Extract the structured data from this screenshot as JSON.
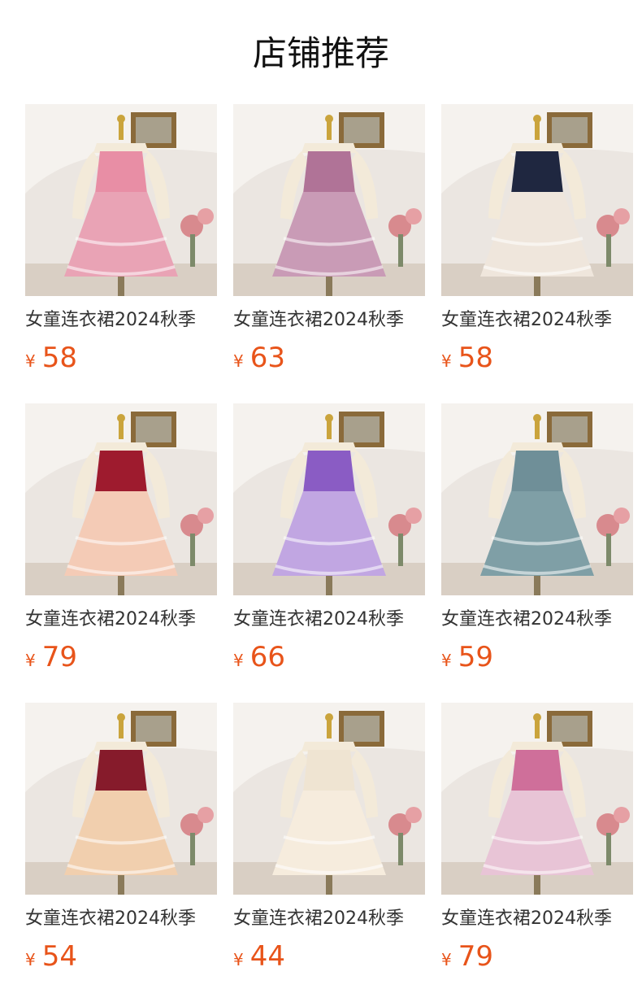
{
  "header": {
    "title": "店铺推荐"
  },
  "products": [
    {
      "name": "女童连衣裙2024秋季",
      "currency": "¥",
      "price": "58",
      "dress_color": "#e9a3b5",
      "top_color": "#e88ea5",
      "icon": "pink-tiered-dress-photo"
    },
    {
      "name": "女童连衣裙2024秋季",
      "currency": "¥",
      "price": "63",
      "dress_color": "#c99bb6",
      "top_color": "#b07397",
      "icon": "mauve-ruffle-dress-photo"
    },
    {
      "name": "女童连衣裙2024秋季",
      "currency": "¥",
      "price": "58",
      "dress_color": "#efe6dc",
      "top_color": "#1f2740",
      "icon": "navy-sequin-tulle-dress-photo"
    },
    {
      "name": "女童连衣裙2024秋季",
      "currency": "¥",
      "price": "79",
      "dress_color": "#f4cbb6",
      "top_color": "#9e1b2e",
      "icon": "burgundy-velvet-tiered-dress-photo"
    },
    {
      "name": "女童连衣裙2024秋季",
      "currency": "¥",
      "price": "66",
      "dress_color": "#c1a6e2",
      "top_color": "#8a5cc4",
      "icon": "purple-sequin-tiered-dress-photo"
    },
    {
      "name": "女童连衣裙2024秋季",
      "currency": "¥",
      "price": "59",
      "dress_color": "#7f9fa6",
      "top_color": "#6f8f98",
      "icon": "teal-tulle-dress-photo"
    },
    {
      "name": "女童连衣裙2024秋季",
      "currency": "¥",
      "price": "54",
      "dress_color": "#f1cfae",
      "top_color": "#861b2b",
      "icon": "burgundy-collar-tulle-dress-photo"
    },
    {
      "name": "女童连衣裙2024秋季",
      "currency": "¥",
      "price": "44",
      "dress_color": "#f6ecdd",
      "top_color": "#efe4d2",
      "icon": "cream-tiered-dress-photo"
    },
    {
      "name": "女童连衣裙2024秋季",
      "currency": "¥",
      "price": "79",
      "dress_color": "#e8c4d6",
      "top_color": "#cf6f9a",
      "icon": "pink-sequin-tulle-dress-photo"
    }
  ]
}
